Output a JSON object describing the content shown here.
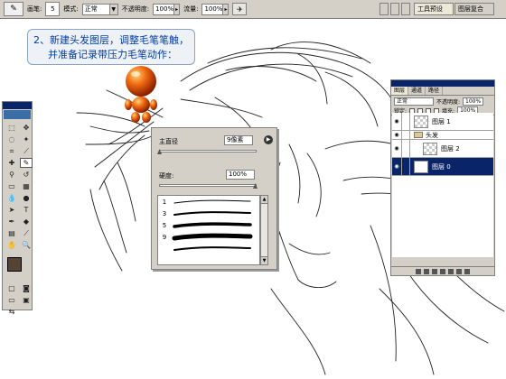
{
  "options_bar": {
    "brush_label": "画笔:",
    "brush_size": "5",
    "mode_label": "模式:",
    "mode_value": "正常",
    "opacity_label": "不透明度:",
    "opacity_value": "100%",
    "flow_label": "流量:",
    "flow_value": "100%",
    "wells": [
      "工具预设",
      "图层复合"
    ]
  },
  "callout": {
    "line1": "2、新建头发图层，调整毛笔笔触，",
    "line2": "并准备记录带压力毛笔动作："
  },
  "brush_panel": {
    "diameter_label": "主直径",
    "diameter_value": "9像素",
    "hardness_label": "硬度:",
    "hardness_value": "100%",
    "diameter_pct": 0.0,
    "hardness_pct": 1.0,
    "presets": [
      {
        "num": "1",
        "thickness": 1
      },
      {
        "num": "3",
        "thickness": 2
      },
      {
        "num": "5",
        "thickness": 3.5
      },
      {
        "num": "9",
        "thickness": 5
      },
      {
        "num": "",
        "thickness": 2
      }
    ]
  },
  "layers_panel": {
    "tabs": [
      "图层",
      "通道",
      "路径"
    ],
    "blend_mode": "正常",
    "opacity_label": "不透明度:",
    "opacity_value": "100%",
    "lock_label": "锁定:",
    "fill_label": "填充:",
    "fill_value": "100%",
    "rows": [
      {
        "name": "图层 1",
        "kind": "layer",
        "thumb": "checker"
      },
      {
        "name": "头发",
        "kind": "group",
        "thumb": "folder"
      },
      {
        "name": "图层 2",
        "kind": "layer",
        "thumb": "checker",
        "indent": true
      },
      {
        "name": "图层 0",
        "kind": "layer",
        "thumb": "sketch",
        "selected": true
      }
    ]
  },
  "colors": {
    "foreground": "#554433",
    "background": "#ffffff",
    "accent": "#0a246a"
  }
}
